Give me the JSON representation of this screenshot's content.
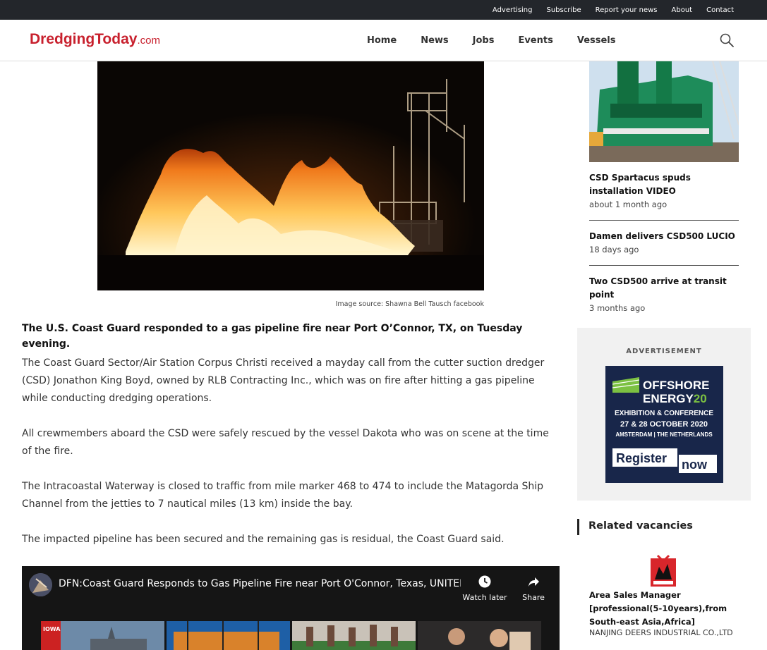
{
  "topbar": {
    "links": [
      "Advertising",
      "Subscribe",
      "Report your news",
      "About",
      "Contact"
    ]
  },
  "header": {
    "logo_main": "DredgingToday",
    "logo_suffix": ".com",
    "nav": [
      "Home",
      "News",
      "Jobs",
      "Events",
      "Vessels"
    ],
    "search_icon": "search-icon"
  },
  "article": {
    "image_caption": "Image source: Shawna Bell Tausch facebook",
    "lead": "The U.S. Coast Guard responded to a gas pipeline fire near Port O’Connor, TX, on Tuesday evening.",
    "paragraphs": [
      "The Coast Guard Sector/Air Station Corpus Christi received a mayday call from the cutter suction dredger (CSD) Jonathon King Boyd, owned by RLB Contracting Inc., which was on fire after hitting a gas pipeline while conducting dredging operations.",
      "All crewmembers aboard the CSD were safely rescued by the vessel Dakota who was on scene at the time of the fire.",
      "The Intracoastal Waterway is closed to traffic from mile marker 468 to 474 to include the Matagorda Ship Channel from the jetties to 7 nautical miles (13 km) inside the bay.",
      "The impacted pipeline has been secured and the remaining gas is residual, the Coast Guard said."
    ]
  },
  "video": {
    "title": "DFN:Coast Guard Responds to Gas Pipeline Fire near Port O'Connor, Texas, UNITED ...",
    "watch_later": "Watch later",
    "share": "Share",
    "thumb_label": "IOWA"
  },
  "sidebar": {
    "news": [
      {
        "title": "CSD Spartacus spuds installation VIDEO",
        "date": "about 1 month ago"
      },
      {
        "title": "Damen delivers CSD500 LUCIO",
        "date": "18 days ago"
      },
      {
        "title": "Two CSD500 arrive at transit point",
        "date": "3 months ago"
      }
    ],
    "ad_label": "ADVERTISEMENT",
    "ad": {
      "line1": "OFFSHORE",
      "line2": "ENERGY",
      "line2_num": "20",
      "line3": "EXHIBITION & CONFERENCE",
      "line4": "27 & 28 OCTOBER 2020",
      "line5": "AMSTERDAM | THE NETHERLANDS",
      "cta1": "Register",
      "cta2": "now"
    },
    "related_title": "Related vacancies",
    "job": {
      "title": "Area Sales Manager [professional(5-10years),from South-east Asia,Africa]",
      "company": "NANJING DEERS INDUSTRIAL CO.,LTD"
    }
  },
  "colors": {
    "brand_red": "#c8202d",
    "topbar_bg": "#23262b",
    "ad_bg": "#18264a",
    "ad_green": "#7cc142"
  }
}
